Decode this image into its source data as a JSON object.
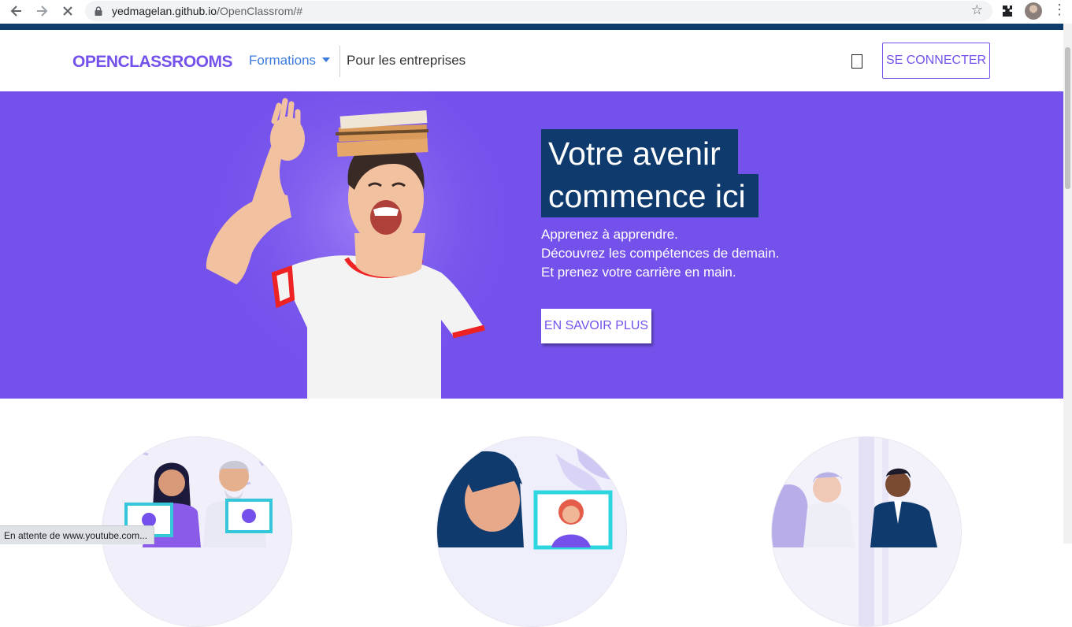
{
  "browser": {
    "url_host": "yedmagelan.github.io",
    "url_path": "/OpenClassrom/#",
    "status_text": "En attente de www.youtube.com..."
  },
  "header": {
    "logo": "OPENCLASSROOMS",
    "nav": {
      "formations": "Formations",
      "entreprises": "Pour les entreprises"
    },
    "login_label": "SE CONNECTER"
  },
  "hero": {
    "title_line1": "Votre avenir",
    "title_line2": "commence ici",
    "subtitle": [
      "Apprenez à apprendre.",
      "Découvrez les compétences de demain.",
      "Et prenez votre carrière en main."
    ],
    "cta_label": "EN SAVOIR PLUS"
  },
  "colors": {
    "brand_purple": "#7451eb",
    "title_bg": "#0f3a6e",
    "link_blue": "#3b7be0"
  },
  "icons": [
    "back-icon",
    "forward-icon",
    "stop-icon",
    "lock-icon",
    "star-icon",
    "extensions-icon",
    "profile-avatar",
    "menu-icon"
  ]
}
